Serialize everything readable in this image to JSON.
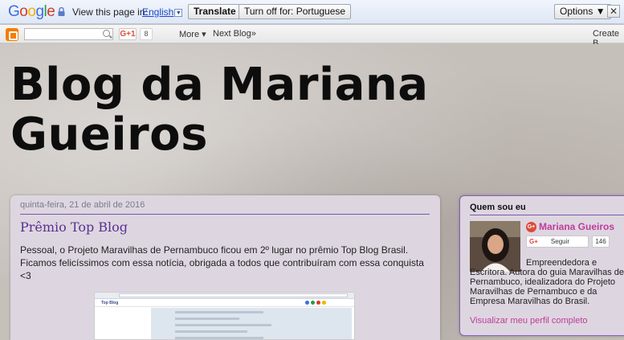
{
  "translate_bar": {
    "logo": [
      "G",
      "o",
      "o",
      "g",
      "l",
      "e"
    ],
    "logo_colors": [
      "#3b6fe0",
      "#d23c2a",
      "#f0b400",
      "#3b6fe0",
      "#2c9a44",
      "#d23c2a"
    ],
    "prompt": "View this page in:",
    "language": "English",
    "translate_label": "Translate",
    "turn_off_label": "Turn off for: Portuguese",
    "options_label": "Options ▼",
    "close_label": "✕"
  },
  "navbar": {
    "gplus_label": "G+1",
    "gplus_count": "8",
    "more_label": "More ▾",
    "next_blog_label": "Next Blog»",
    "create_label": "Create B"
  },
  "blog": {
    "title": "Blog da Mariana Gueiros"
  },
  "post": {
    "date": "quinta-feira, 21 de abril de 2016",
    "title": "Prêmio Top Blog",
    "body": "Pessoal, o Projeto Maravilhas de Pernambuco ficou em 2º lugar no prêmio Top Blog Brasil. Ficamos felicíssimos com essa notícia, obrigada a todos que contribuíram com essa conquista <3",
    "thumb_site": "Top Blog"
  },
  "sidebar": {
    "title": "Quem sou eu",
    "name": "Mariana Gueiros",
    "follow_label": "Seguir",
    "follow_g": "G+",
    "follow_count": "146",
    "about": "Empreendedora e Escritora. Autora do guia Maravilhas de Pernambuco, idealizadora do Projeto Maravilhas de Pernambuco e da Empresa Maravilhas do Brasil.",
    "profile_link": "Visualizar meu perfil completo"
  }
}
